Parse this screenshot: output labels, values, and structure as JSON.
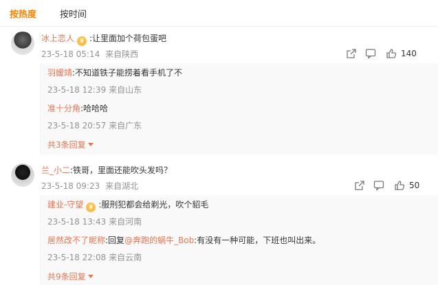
{
  "tabs": {
    "hot": "按热度",
    "time": "按时间"
  },
  "comments": [
    {
      "user": "冰上恋人",
      "text": ":让里面加个荷包蛋吧",
      "time": "23-5-18 05:14",
      "location": "来自陕西",
      "likes": "140",
      "replies": [
        {
          "user": "羽嫒靖",
          "text": ":不知道铁子能捞着看手机了不",
          "time": "23-5-18 12:39",
          "location": "来自山东"
        },
        {
          "user": "准十分角",
          "text": ":哈哈哈",
          "time": "23-5-18 20:57",
          "location": "来自广东"
        }
      ],
      "more": "共3条回复"
    },
    {
      "user": "兰_小二",
      "text": ":铁哥，里面还能吹头发吗？",
      "time": "23-5-18 09:23",
      "location": "来自湖北",
      "likes": "50",
      "replies": [
        {
          "user": "建业-守望",
          "text": ":服刑犯都会给剃光，吹个貂毛",
          "time": "23-5-18 13:43",
          "location": "来自河南"
        },
        {
          "user": "居然改不了昵称",
          "text_pre": ":回复",
          "mention": "@奔跑的蜗牛_Bob",
          "text_post": ":有没有一种可能，下班也叫出来。",
          "time": "23-5-18 22:08",
          "location": "来自云南"
        }
      ],
      "more": "共9条回复"
    }
  ],
  "icons": {
    "share": "share-icon",
    "comment": "comment-icon",
    "like": "thumbs-up-icon",
    "crown": "crown-badge-icon"
  },
  "colors": {
    "accent": "#ff8200",
    "username": "#eb7350",
    "meta": "#939393"
  }
}
